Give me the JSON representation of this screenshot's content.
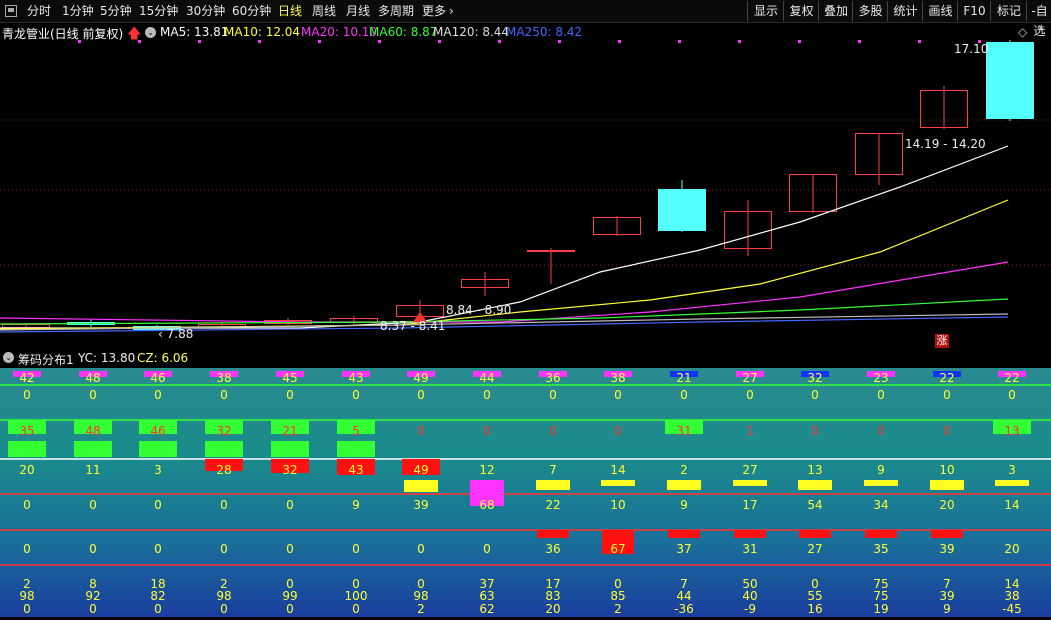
{
  "toolbar": {
    "periods": [
      "分时",
      "1分钟",
      "5分钟",
      "15分钟",
      "30分钟",
      "60分钟",
      "日线",
      "周线",
      "月线",
      "多周期",
      "更多"
    ],
    "active_period": "日线",
    "tools": [
      "显示",
      "复权",
      "叠加",
      "多股",
      "统计",
      "画线",
      "F10",
      "标记",
      "-自选"
    ]
  },
  "main": {
    "title": "青龙管业(日线 前复权)",
    "ma": [
      {
        "label": "MA5: 13.81",
        "color": "#ffffff"
      },
      {
        "label": "MA10: 12.04",
        "color": "#ffff33"
      },
      {
        "label": "MA20: 10.10",
        "color": "#ff33ff"
      },
      {
        "label": "MA60: 8.87",
        "color": "#33ff33"
      },
      {
        "label": "MA120: 8.44",
        "color": "#dddddd"
      },
      {
        "label": "MA250: 8.42",
        "color": "#4466ff"
      }
    ],
    "high_label": "17.10",
    "range_label": "14.19 - 14.20",
    "label_mid": "8.84 - 8.90",
    "label_low": "8.37 - 8.41",
    "label_min": "7.88",
    "zhang": "涨",
    "colors": {
      "up": "#ff4040",
      "down": "#55ffff"
    }
  },
  "panel2": {
    "title": "筹码分布1",
    "yc": "YC: 13.80",
    "cz": "CZ: 6.06",
    "rows": [
      [
        "42",
        "48",
        "46",
        "38",
        "45",
        "43",
        "49",
        "44",
        "36",
        "38",
        "21",
        "27",
        "32",
        "23",
        "22",
        "22"
      ],
      [
        "0",
        "0",
        "0",
        "0",
        "0",
        "0",
        "0",
        "0",
        "0",
        "0",
        "0",
        "0",
        "0",
        "0",
        "0",
        "0"
      ],
      [
        "35",
        "48",
        "46",
        "32",
        "21",
        "5",
        "0",
        "0",
        "0",
        "0",
        "31",
        "1",
        "0",
        "0",
        "0",
        "13"
      ],
      [
        "20",
        "11",
        "3",
        "28",
        "32",
        "43",
        "49",
        "12",
        "7",
        "14",
        "2",
        "27",
        "13",
        "9",
        "10",
        "3"
      ],
      [
        "0",
        "0",
        "0",
        "0",
        "0",
        "9",
        "39",
        "68",
        "22",
        "10",
        "9",
        "17",
        "54",
        "34",
        "20",
        "14"
      ],
      [
        "0",
        "0",
        "0",
        "0",
        "0",
        "0",
        "0",
        "0",
        "36",
        "67",
        "37",
        "31",
        "27",
        "35",
        "39",
        "20"
      ],
      [
        "2",
        "8",
        "18",
        "2",
        "0",
        "0",
        "0",
        "37",
        "17",
        "0",
        "7",
        "50",
        "0",
        "75",
        "7",
        "14"
      ],
      [
        "98",
        "92",
        "82",
        "98",
        "99",
        "100",
        "98",
        "63",
        "83",
        "85",
        "44",
        "40",
        "55",
        "75",
        "39",
        "38"
      ],
      [
        "0",
        "0",
        "0",
        "0",
        "0",
        "0",
        "2",
        "62",
        "20",
        "2",
        "-36",
        "-9",
        "16",
        "19",
        "9",
        "-45"
      ]
    ]
  }
}
